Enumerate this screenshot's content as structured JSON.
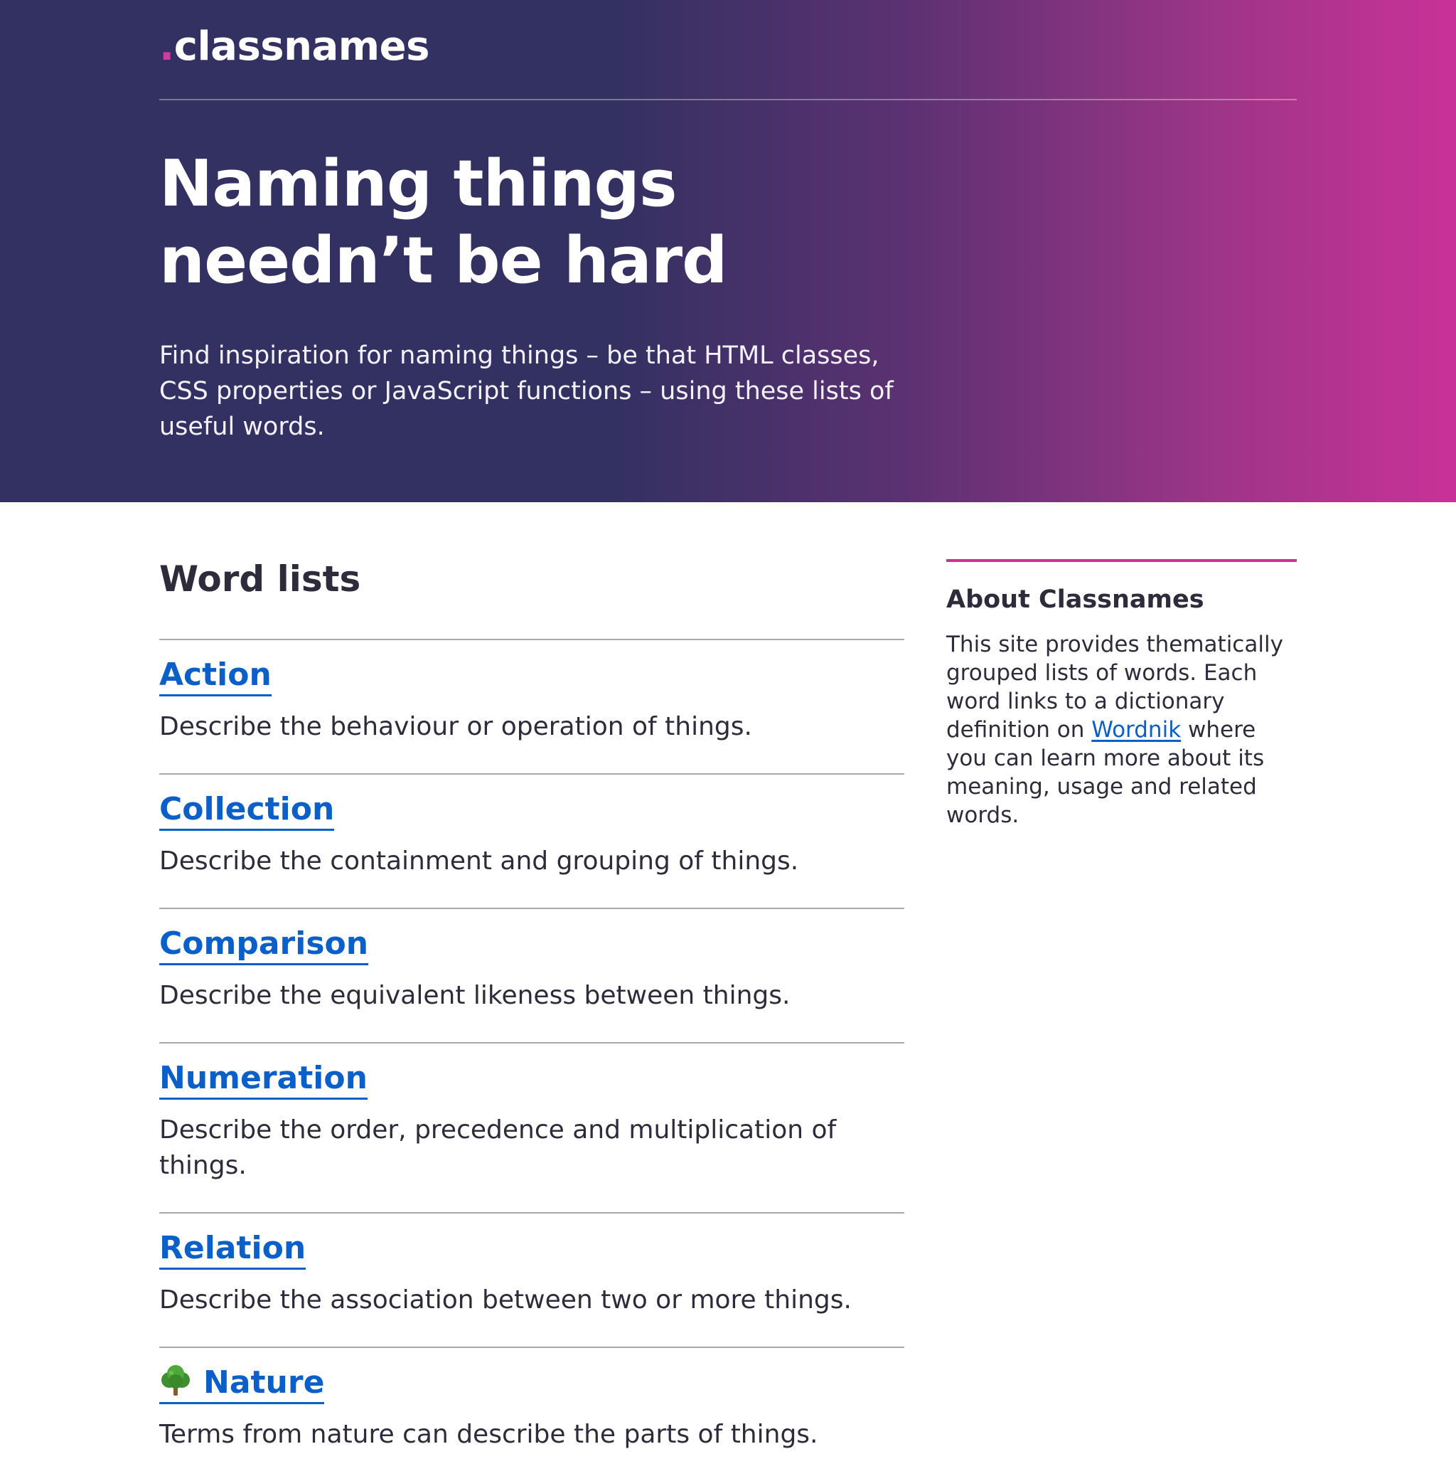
{
  "header": {
    "logo_dot": ".",
    "logo_text": "classnames",
    "title_line1": "Naming things",
    "title_line2": "needn’t be hard",
    "lede": "Find inspiration for naming things – be that HTML classes, CSS properties or JavaScript functions – using these lists of useful words."
  },
  "word_lists": {
    "title": "Word lists",
    "items": [
      {
        "label": "Action",
        "description": "Describe the behaviour or operation of things."
      },
      {
        "label": "Collection",
        "description": "Describe the containment and grouping of things."
      },
      {
        "label": "Comparison",
        "description": "Describe the equivalent likeness between things."
      },
      {
        "label": "Numeration",
        "description": "Describe the order, precedence and multiplication of things."
      },
      {
        "label": "Relation",
        "description": "Describe the association between two or more things."
      },
      {
        "label": "Nature",
        "icon": "tree-icon",
        "description": "Terms from nature can describe the parts of things."
      }
    ]
  },
  "about": {
    "title": "About Classnames",
    "text_before": "This site provides thematically grouped lists of words. Each word links to a dictionary definition on ",
    "link_label": "Wordnik",
    "text_after": " where you can learn more about its meaning, usage and related words."
  },
  "colors": {
    "gradient_start": "#323161",
    "gradient_end": "#c93298",
    "accent": "#cf2f95",
    "link": "#0a5fc9",
    "text": "#2e2c3b"
  }
}
